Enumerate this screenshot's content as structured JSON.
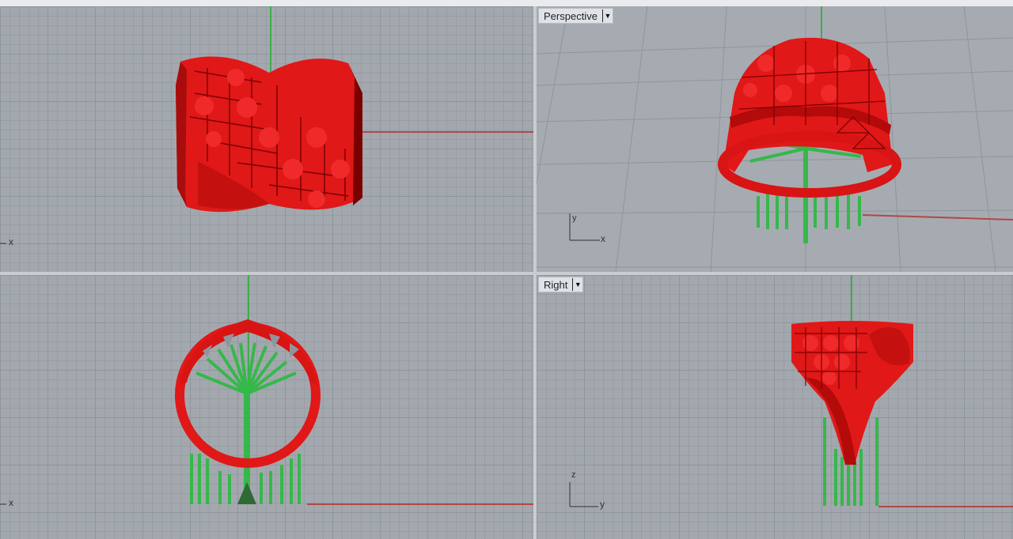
{
  "viewports": {
    "top": {
      "x_axis": "x"
    },
    "perspective": {
      "label": "Perspective",
      "x_axis": "x",
      "y_axis": "y"
    },
    "front": {
      "x_axis": "x"
    },
    "right": {
      "label": "Right",
      "y_axis": "y",
      "z_axis": "z"
    }
  },
  "icons": {
    "dropdown": "chevron-down-icon"
  },
  "colors": {
    "model": "#e01818",
    "supports": "#35b84a",
    "x_axis_line": "#b04848",
    "y_axis_line": "#3cae4a",
    "grid_bg": "#a3a8ae"
  }
}
